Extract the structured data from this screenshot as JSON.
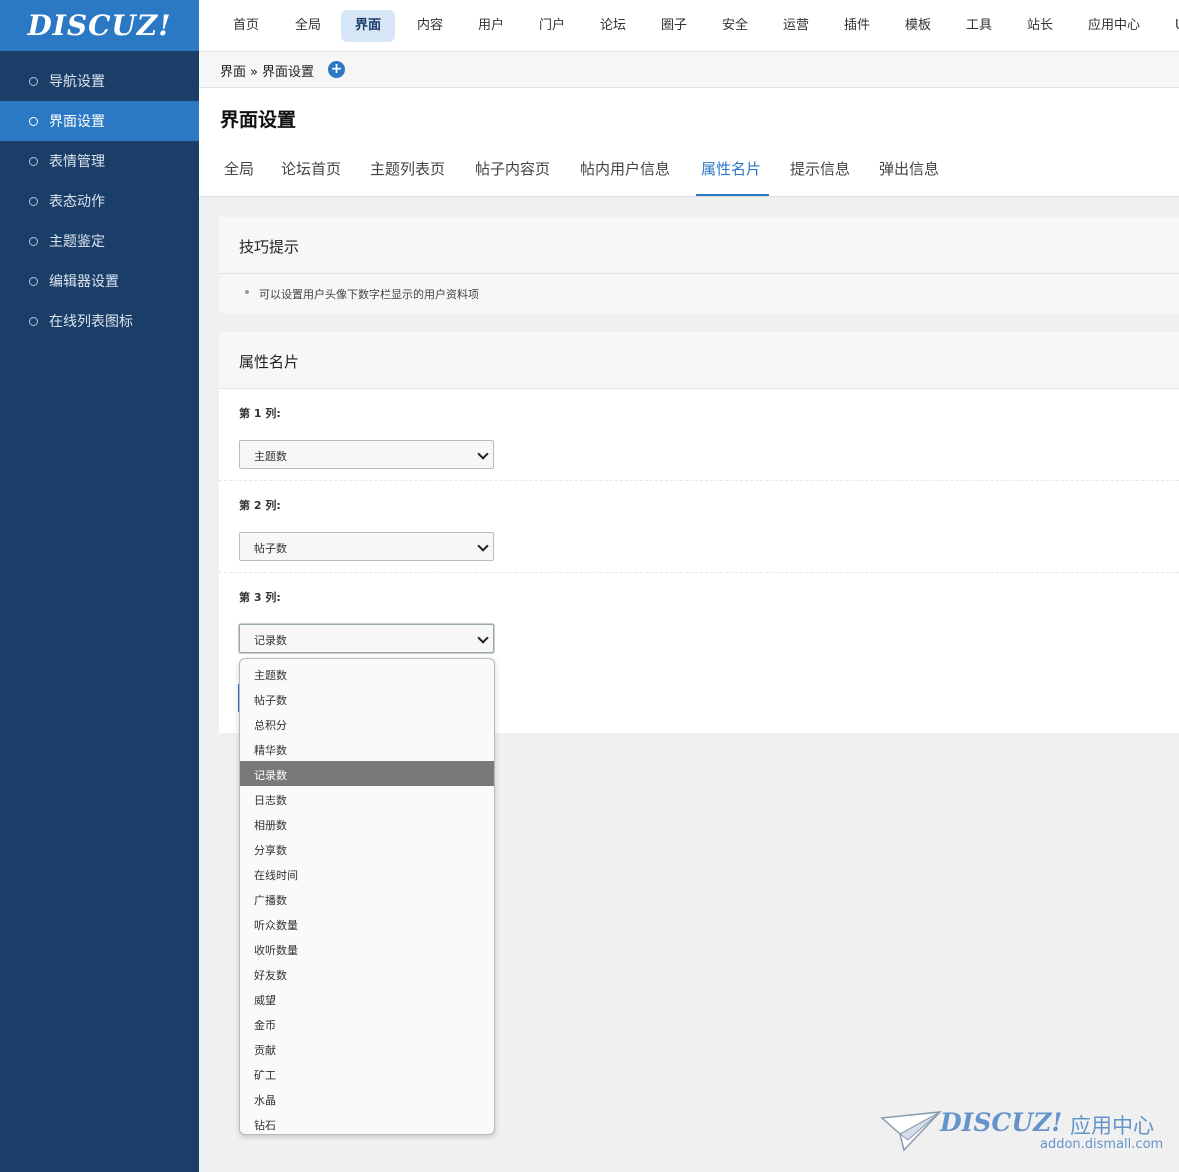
{
  "logo": "DISCUZ!",
  "sidebar": {
    "items": [
      {
        "label": "导航设置"
      },
      {
        "label": "界面设置",
        "active": true
      },
      {
        "label": "表情管理"
      },
      {
        "label": "表态动作"
      },
      {
        "label": "主题鉴定"
      },
      {
        "label": "编辑器设置"
      },
      {
        "label": "在线列表图标"
      }
    ]
  },
  "topnav": {
    "items": [
      "首页",
      "全局",
      "界面",
      "内容",
      "用户",
      "门户",
      "论坛",
      "圈子",
      "安全",
      "运营",
      "插件",
      "模板",
      "工具",
      "站长",
      "应用中心",
      "U"
    ],
    "active": "界面"
  },
  "breadcrumb": {
    "parent": "界面",
    "separator": "»",
    "current": "界面设置"
  },
  "page": {
    "title": "界面设置",
    "tabs": [
      "全局",
      "论坛首页",
      "主题列表页",
      "帖子内容页",
      "帖内用户信息",
      "属性名片",
      "提示信息",
      "弹出信息"
    ],
    "active_tab": "属性名片"
  },
  "tips": {
    "title": "技巧提示",
    "items": [
      "可以设置用户头像下数字栏显示的用户资料项"
    ]
  },
  "form": {
    "title": "属性名片",
    "columns": [
      {
        "label": "第 1 列:",
        "value": "主题数"
      },
      {
        "label": "第 2 列:",
        "value": "帖子数"
      },
      {
        "label": "第 3 列:",
        "value": "记录数"
      }
    ]
  },
  "dropdown": {
    "options": [
      "主题数",
      "帖子数",
      "总积分",
      "精华数",
      "记录数",
      "日志数",
      "相册数",
      "分享数",
      "在线时间",
      "广播数",
      "听众数量",
      "收听数量",
      "好友数",
      "威望",
      "金币",
      "贡献",
      "矿工",
      "水晶",
      "钻石"
    ],
    "selected": "记录数"
  },
  "watermark": {
    "logo": "DISCUZ!",
    "text": "应用中心",
    "url": "addon.dismall.com"
  },
  "colors": {
    "sidebar": "#1b3e69",
    "accent": "#2b78c4",
    "selected_option": "#797979"
  }
}
